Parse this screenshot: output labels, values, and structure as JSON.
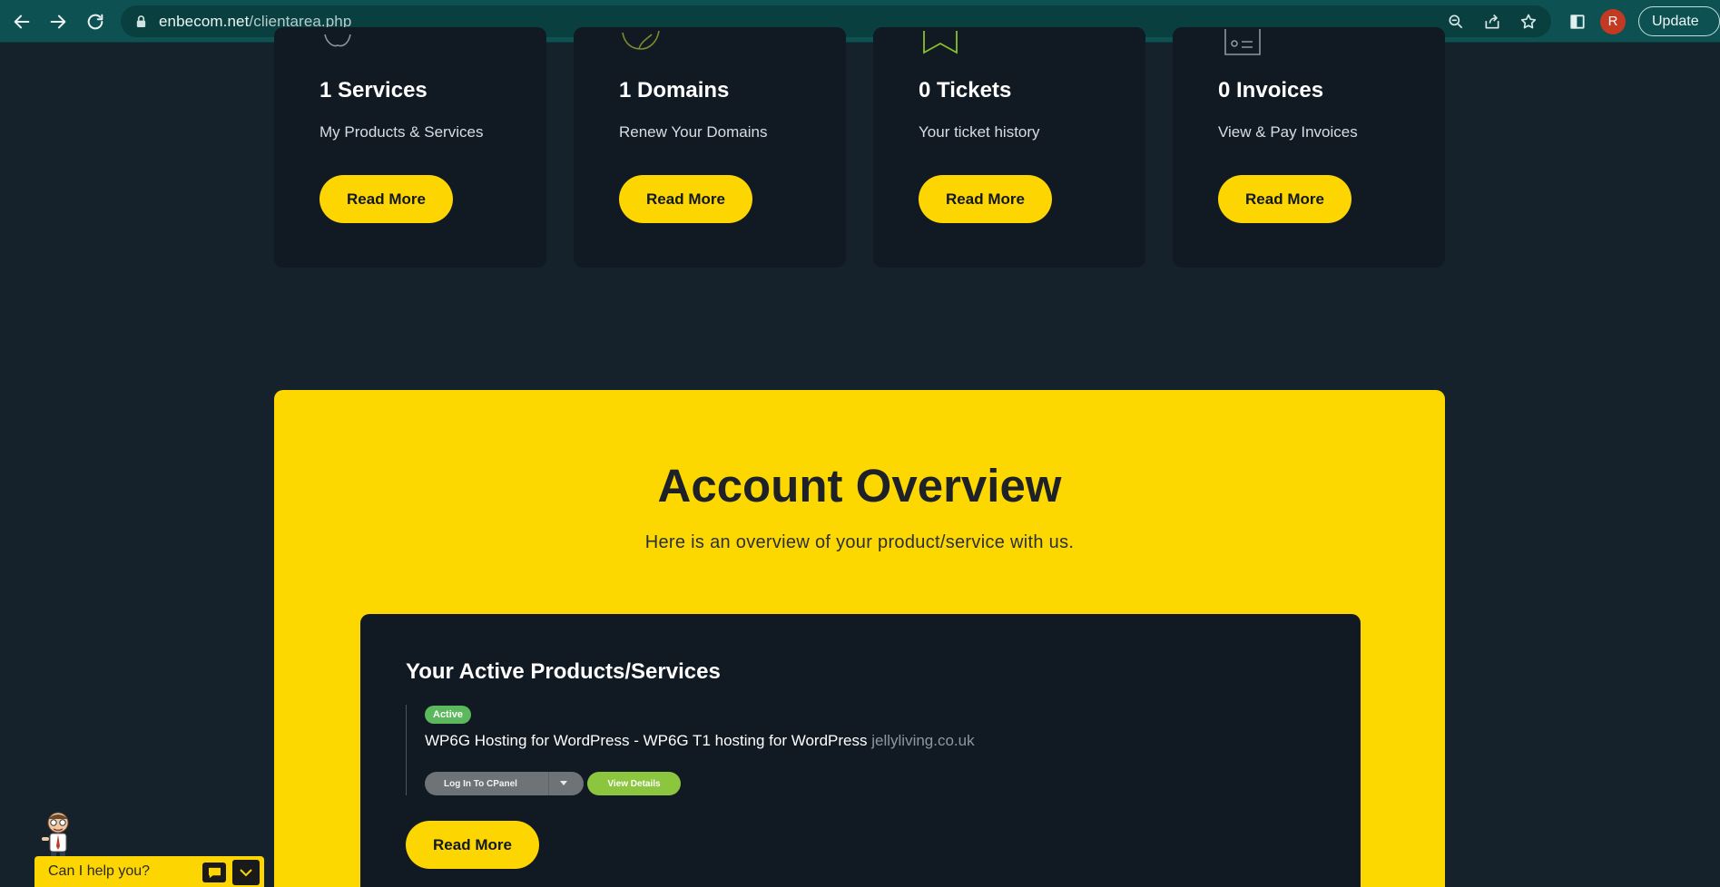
{
  "browser": {
    "url_domain": "enbecom.net",
    "url_path": "/clientarea.php",
    "avatar_initial": "R",
    "update_label": "Update",
    "icons": [
      "back-icon",
      "forward-icon",
      "reload-icon",
      "lock-icon",
      "zoom-icon",
      "share-icon",
      "star-icon",
      "side-panel-icon"
    ]
  },
  "stats": [
    {
      "title": "1 Services",
      "subtitle": "My Products & Services",
      "button": "Read More",
      "icon": "services-icon"
    },
    {
      "title": "1 Domains",
      "subtitle": "Renew Your Domains",
      "button": "Read More",
      "icon": "globe-icon"
    },
    {
      "title": "0 Tickets",
      "subtitle": "Your ticket history",
      "button": "Read More",
      "icon": "ribbon-icon"
    },
    {
      "title": "0 Invoices",
      "subtitle": "View & Pay Invoices",
      "button": "Read More",
      "icon": "invoice-icon"
    }
  ],
  "overview": {
    "title": "Account Overview",
    "subtitle": "Here is an overview of your product/service with us.",
    "panel_title": "Your Active Products/Services",
    "product": {
      "status": "Active",
      "name": "WP6G Hosting for WordPress - WP6G T1 hosting for WordPress",
      "domain": "jellyliving.co.uk",
      "cpanel_label": "Log In To CPanel",
      "details_label": "View Details"
    },
    "read_more": "Read More"
  },
  "chat": {
    "prompt": "Can I help you?"
  },
  "colors": {
    "accent_yellow": "#fdd500",
    "page_bg": "#15212b",
    "card_bg": "#111a23",
    "active_green": "#5cb85c",
    "details_green": "#8cc63f",
    "browser_teal": "#0d5152"
  }
}
